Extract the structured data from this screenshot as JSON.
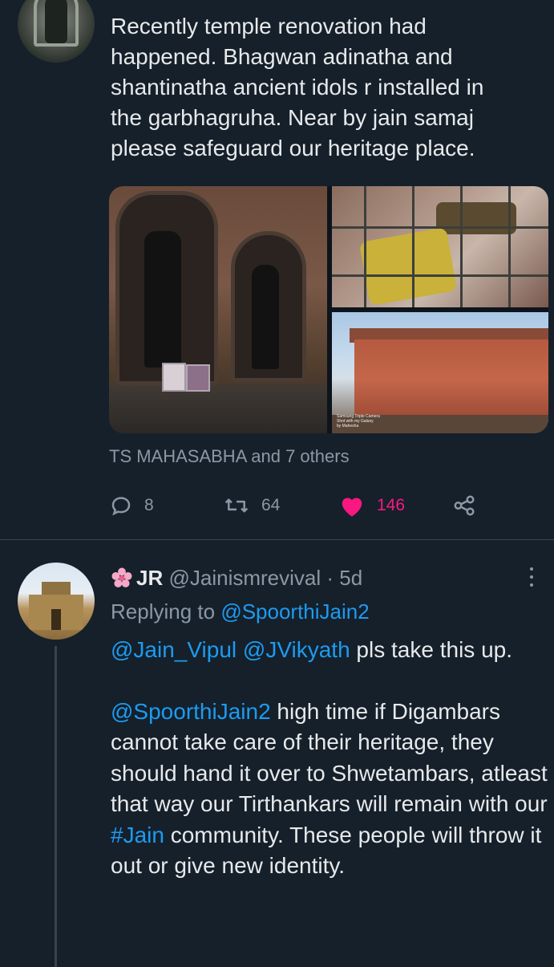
{
  "tweet1": {
    "text": "Recently temple renovation had\nhappened. Bhagwan adinatha and\nshantinatha ancient idols r installed in\nthe garbhagruha. Near by jain samaj\nplease safeguard our heritage place.",
    "photo_watermark": "Samsung Triple Camera\nShot with my Galaxy\nby Mahesha",
    "social_context": "TS MAHASABHA and 7 others",
    "reply_count": "8",
    "retweet_count": "64",
    "like_count": "146",
    "colors": {
      "like": "#f91880",
      "muted": "#8b98a5",
      "background": "#15202b"
    },
    "icons": [
      "reply-icon",
      "retweet-icon",
      "heart-icon",
      "share-icon"
    ]
  },
  "tweet2": {
    "emoji": "cherry-blossom-icon",
    "name": "JR",
    "handle": "@Jainismrevival",
    "separator": "·",
    "time": "5d",
    "replying_prefix": "Replying to",
    "replying_to": "@SpoorthiJain2",
    "para1_mention1": "@Jain_Vipul",
    "para1_mention2": "@JVikyath",
    "para1_text": " pls take this up.",
    "para2_mention": "@SpoorthiJain2",
    "para2_text_a": " high time if Digambars cannot take care of their heritage, they should hand it over to Shwetambars, atleast that way our Tirthankars will remain with our ",
    "para2_hashtag": "#Jain",
    "para2_text_b": " community. These people will throw it out or give new identity.",
    "colors": {
      "link": "#1d9bf0"
    }
  }
}
